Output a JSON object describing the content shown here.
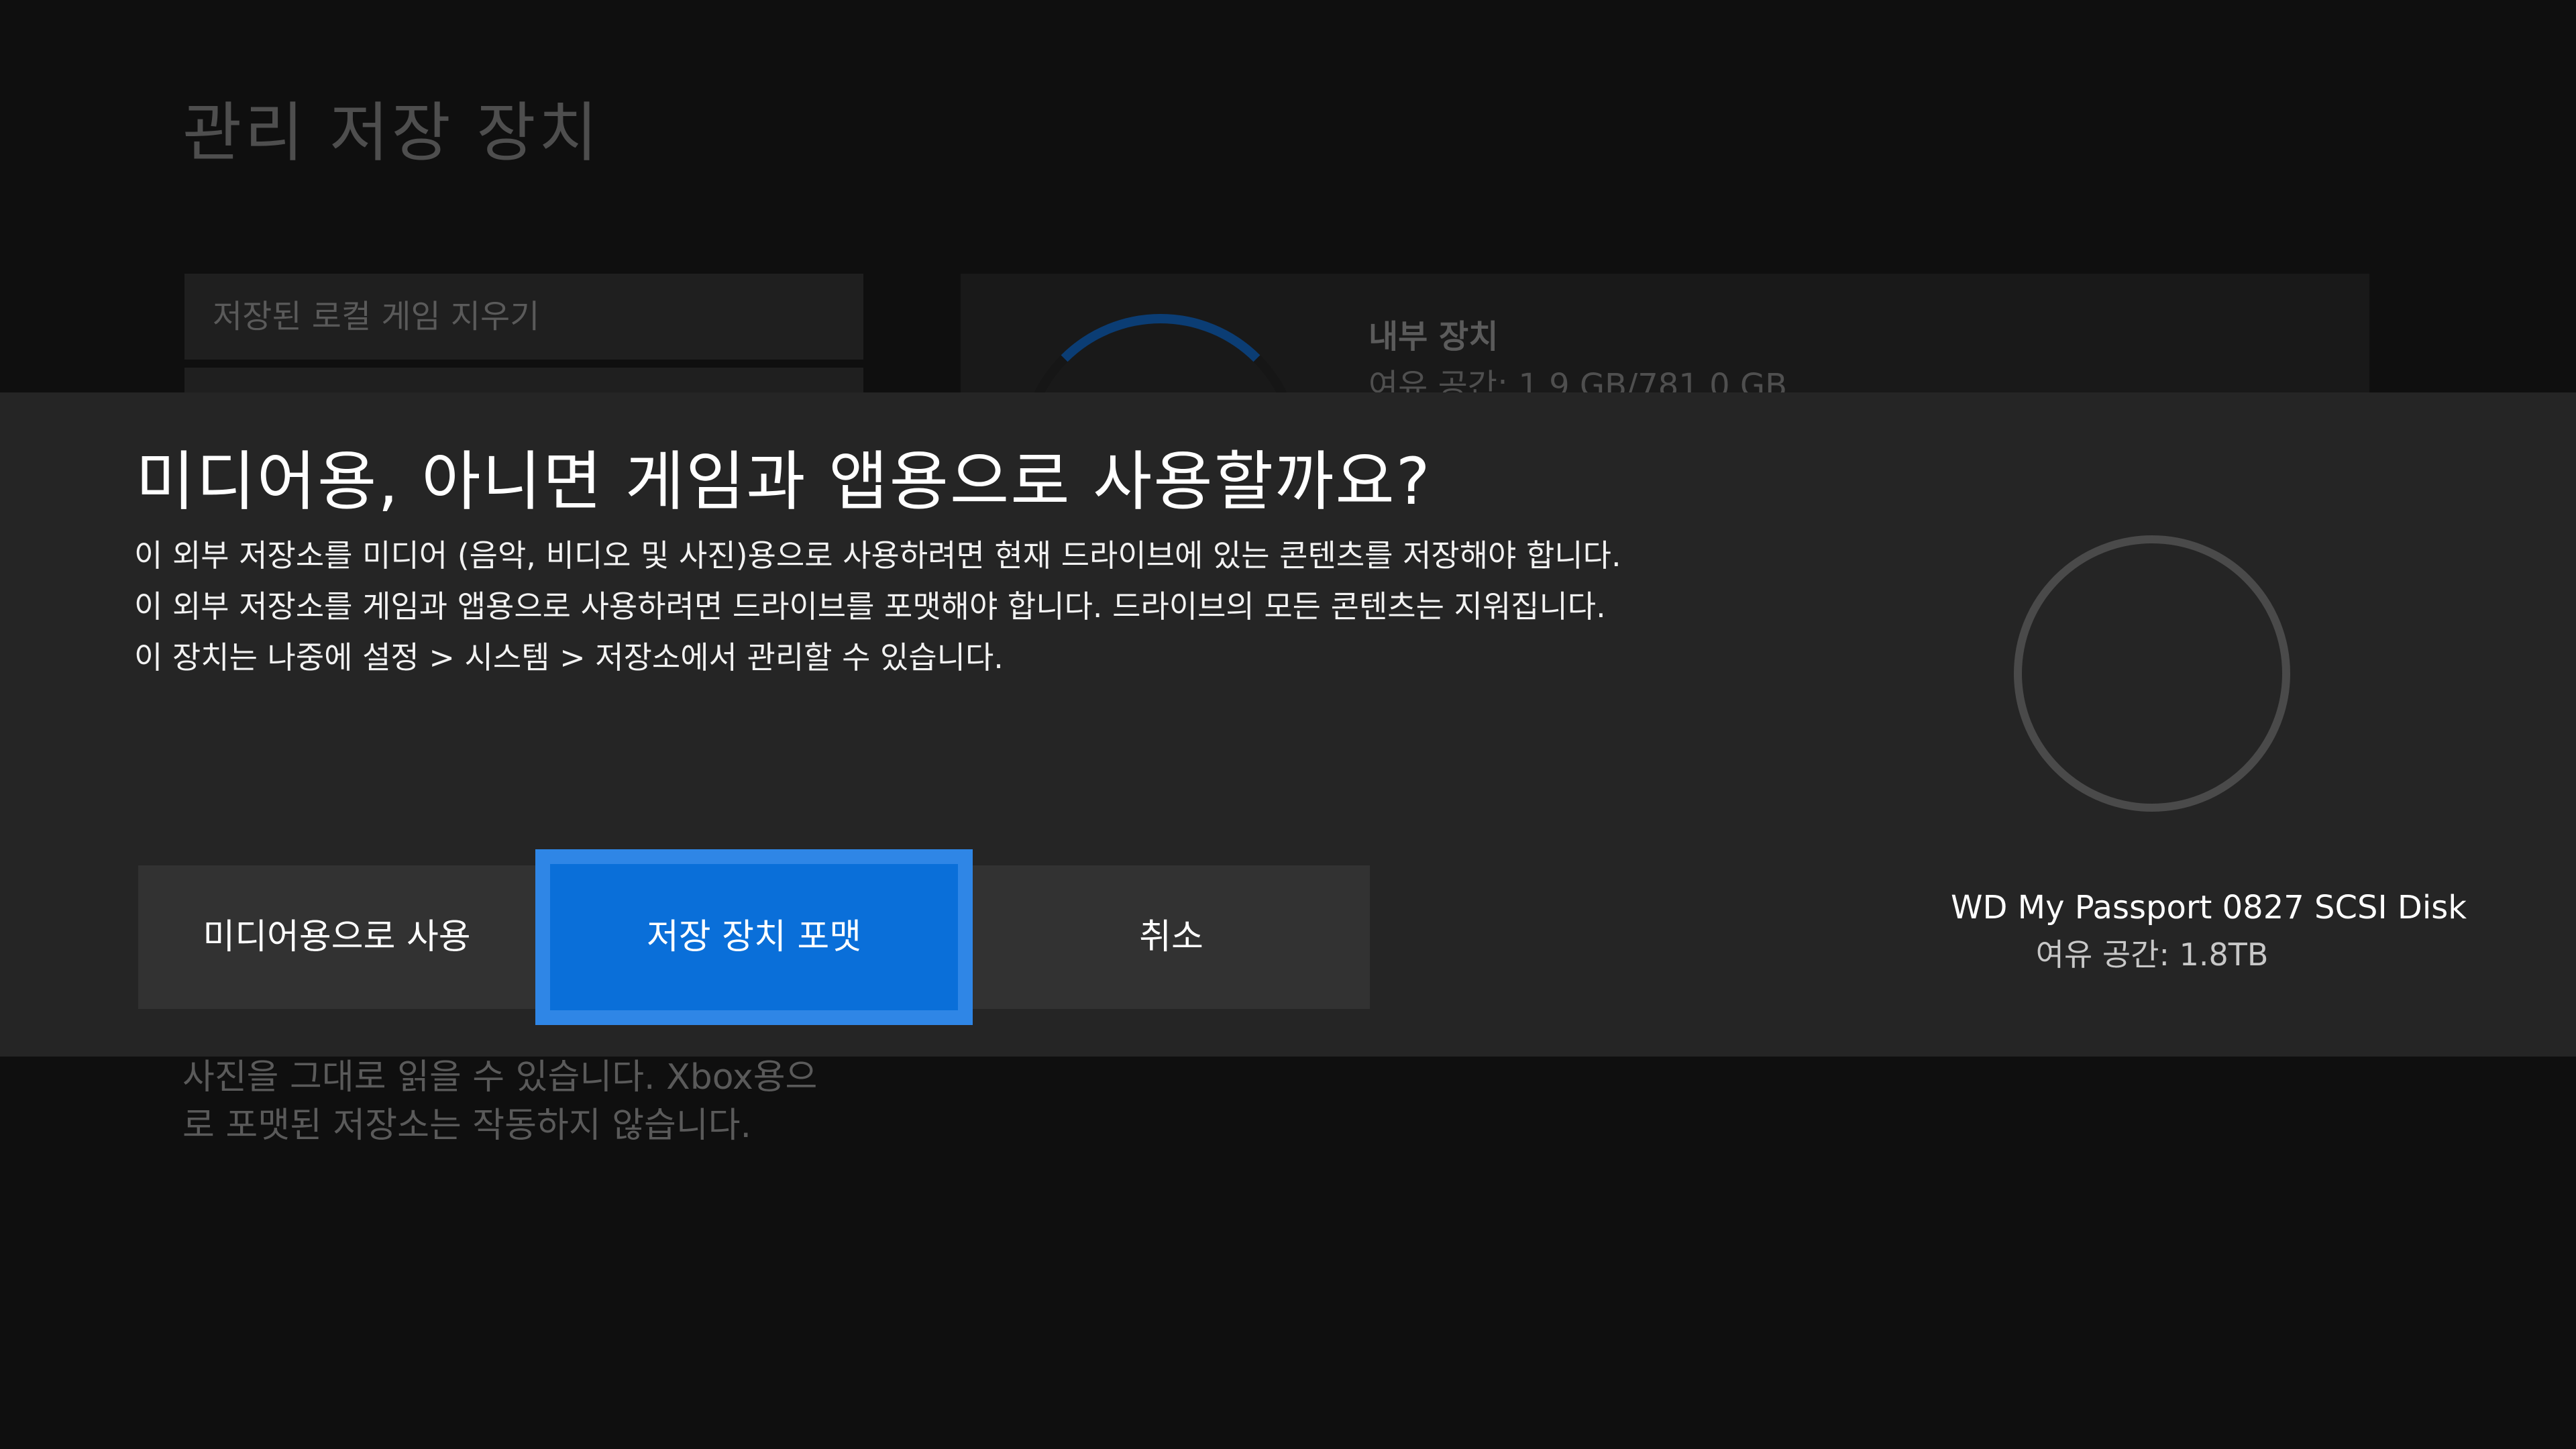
{
  "background": {
    "title": "관리 저장 장치",
    "menu_item": "저장된 로컬 게임 지우기",
    "storage": {
      "name": "내부 장치",
      "free_space": "여유 공간: 1.9 GB/781.0 GB"
    },
    "help_lines": [
      "사진을 그대로 읽을 수 있습니다. Xbox용으",
      "로 포맷된 저장소는 작동하지 않습니다."
    ]
  },
  "dialog": {
    "title": "미디어용, 아니면 게임과 앱용으로 사용할까요?",
    "body_lines": [
      "이 외부 저장소를 미디어 (음악, 비디오 및 사진)용으로 사용하려면 현재 드라이브에 있는 콘텐츠를 저장해야 합니다.",
      "이 외부 저장소를 게임과 앱용으로 사용하려면 드라이브를 포맷해야 합니다. 드라이브의 모든 콘텐츠는 지워집니다.",
      "이 장치는 나중에 설정 > 시스템 > 저장소에서 관리할 수 있습니다."
    ],
    "buttons": {
      "media": "미디어용으로 사용",
      "format": "저장 장치 포맷",
      "cancel": "취소"
    },
    "device": {
      "name": "WD My Passport 0827 SCSI Disk",
      "free_space": "여유 공간: 1.8TB"
    }
  },
  "colors": {
    "accent": "#0a6fd9",
    "dialog_bg": "#252525",
    "page_bg": "#0f0f0f"
  }
}
